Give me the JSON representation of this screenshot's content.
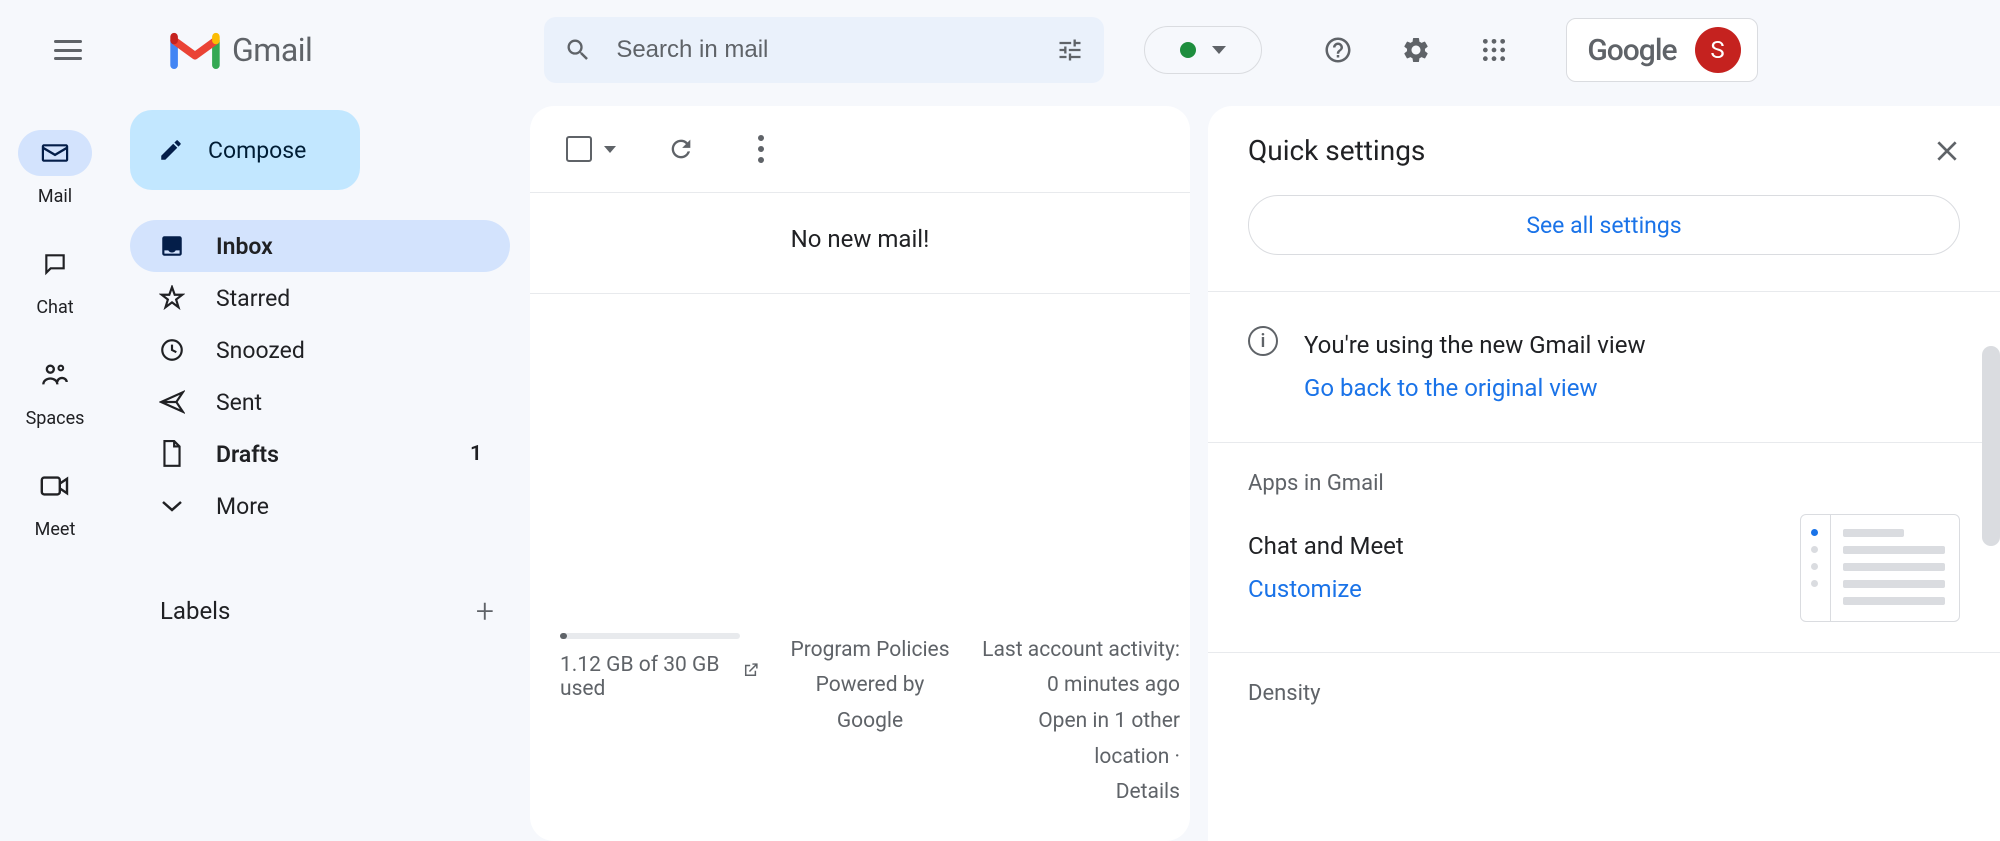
{
  "header": {
    "app_name": "Gmail",
    "search_placeholder": "Search in mail",
    "google_label": "Google",
    "avatar_letter": "S"
  },
  "rail": {
    "mail": "Mail",
    "chat": "Chat",
    "spaces": "Spaces",
    "meet": "Meet"
  },
  "sidebar": {
    "compose": "Compose",
    "inbox": "Inbox",
    "starred": "Starred",
    "snoozed": "Snoozed",
    "sent": "Sent",
    "drafts": "Drafts",
    "drafts_count": "1",
    "more": "More",
    "labels_header": "Labels"
  },
  "main": {
    "empty": "No new mail!",
    "storage_used": "1.12 GB of 30 GB used",
    "program_policies": "Program Policies",
    "powered_by": "Powered by Google",
    "activity_line1": "Last account activity: 0 minutes ago",
    "activity_line2": "Open in 1 other location ·",
    "activity_details": "Details"
  },
  "settings": {
    "title": "Quick settings",
    "see_all": "See all settings",
    "new_view_msg": "You're using the new Gmail view",
    "go_back": "Go back to the original view",
    "apps_label": "Apps in Gmail",
    "chat_meet": "Chat and Meet",
    "customize": "Customize",
    "density_label": "Density"
  }
}
